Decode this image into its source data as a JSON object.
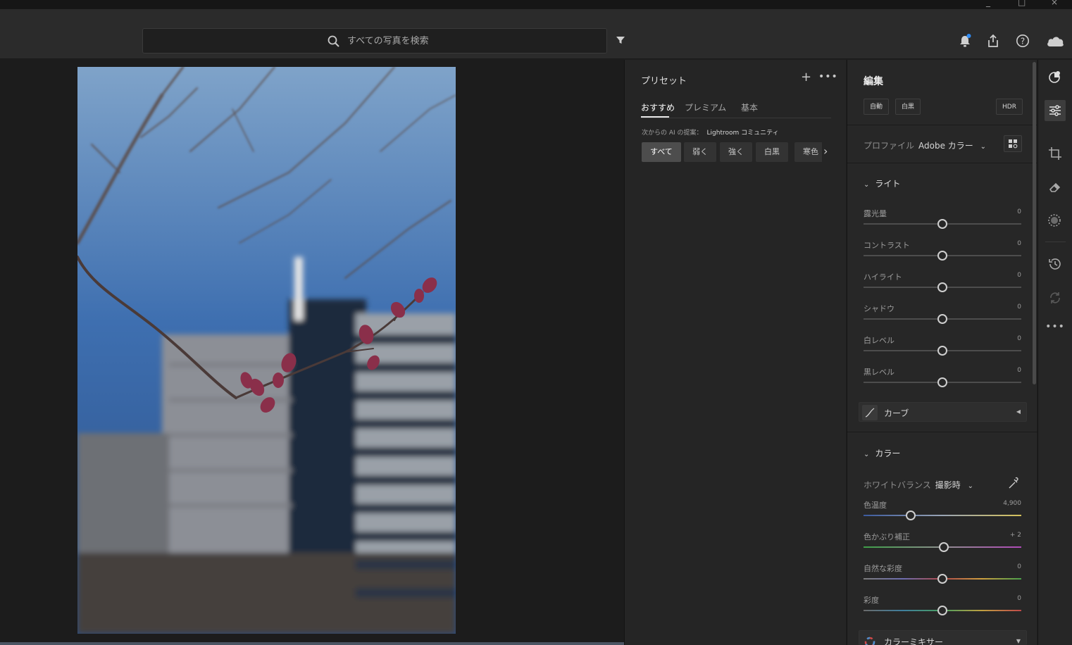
{
  "search": {
    "placeholder": "すべての写真を検索"
  },
  "presets": {
    "title": "プリセット",
    "tabs": [
      "おすすめ",
      "プレミアム",
      "基本"
    ],
    "ai_prefix": "次からの AI の提案：",
    "ai_source": "Lightroom コミュニティ",
    "chips": [
      "すべて",
      "弱く",
      "強く",
      "白黒",
      "寒色"
    ]
  },
  "edit": {
    "title": "編集",
    "auto_label": "自動",
    "bw_label": "白黒",
    "hdr_label": "HDR",
    "profile_label": "プロファイル",
    "profile_value": "Adobe カラー",
    "light": {
      "title": "ライト",
      "sliders": [
        {
          "label": "露光量",
          "value": "0",
          "level": 0.5
        },
        {
          "label": "コントラスト",
          "value": "0",
          "level": 0.5
        },
        {
          "label": "ハイライト",
          "value": "0",
          "level": 0.5
        },
        {
          "label": "シャドウ",
          "value": "0",
          "level": 0.5
        },
        {
          "label": "白レベル",
          "value": "0",
          "level": 0.5
        },
        {
          "label": "黒レベル",
          "value": "0",
          "level": 0.5
        }
      ],
      "curve_label": "カーブ"
    },
    "color": {
      "title": "カラー",
      "wb_label": "ホワイトバランス",
      "wb_value": "撮影時",
      "sliders": [
        {
          "label": "色温度",
          "value": "4,900",
          "level": 0.3
        },
        {
          "label": "色かぶり補正",
          "value": "+ 2",
          "level": 0.51
        },
        {
          "label": "自然な彩度",
          "value": "0",
          "level": 0.5
        },
        {
          "label": "彩度",
          "value": "0",
          "level": 0.5
        }
      ],
      "mixer_label": "カラーミキサー"
    }
  }
}
